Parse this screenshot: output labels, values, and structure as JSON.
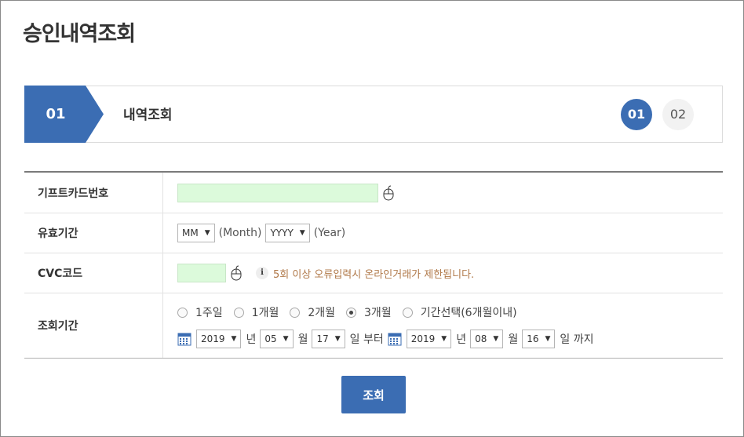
{
  "page": {
    "title": "승인내역조회"
  },
  "steps": {
    "current_number": "01",
    "current_name": "내역조회",
    "indicators": [
      "01",
      "02"
    ],
    "accent_color": "#3b6db3"
  },
  "form": {
    "gift_card": {
      "label": "기프트카드번호",
      "value": ""
    },
    "expiry": {
      "label": "유효기간",
      "month_value": "MM",
      "month_suffix": "(Month)",
      "year_value": "YYYY",
      "year_suffix": "(Year)"
    },
    "cvc": {
      "label": "CVC코드",
      "value": "",
      "info_glyph": "i",
      "warning": "5회 이상 오류입력시 온라인거래가 제한됩니다."
    },
    "period": {
      "label": "조회기간",
      "options": [
        "1주일",
        "1개월",
        "2개월",
        "3개월",
        "기간선택(6개월이내)"
      ],
      "selected": "3개월",
      "start": {
        "year": "2019",
        "month": "05",
        "day": "17"
      },
      "end": {
        "year": "2019",
        "month": "08",
        "day": "16"
      },
      "unit_year": "년",
      "unit_month": "월",
      "unit_day_from": "일 부터",
      "unit_day_to": "일 까지"
    }
  },
  "actions": {
    "search_label": "조회"
  },
  "icons": {
    "dropdown": "▼"
  }
}
